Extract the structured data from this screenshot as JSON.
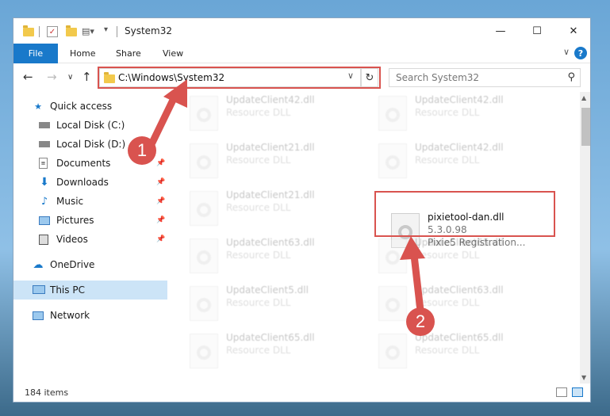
{
  "window": {
    "title": "System32",
    "controls": {
      "minimize": "—",
      "maximize": "☐",
      "close": "✕"
    }
  },
  "ribbon": {
    "tabs": [
      "File",
      "Home",
      "Share",
      "View"
    ],
    "help": "?",
    "collapse": "∨",
    "accent": "#1979ca"
  },
  "nav": {
    "back": "←",
    "forward": "→",
    "recent": "∨",
    "up": "↑",
    "address": "C:\\Windows\\System32",
    "refresh": "↻",
    "search_placeholder": "Search System32"
  },
  "sidebar": {
    "items": [
      {
        "label": "Quick access",
        "icon": "star-icon",
        "pinned": false
      },
      {
        "label": "Local Disk (C:)",
        "icon": "drive-icon",
        "pinned": false
      },
      {
        "label": "Local Disk (D:)",
        "icon": "drive-icon",
        "pinned": false
      },
      {
        "label": "Documents",
        "icon": "document-icon",
        "pinned": true
      },
      {
        "label": "Downloads",
        "icon": "download-icon",
        "pinned": true
      },
      {
        "label": "Music",
        "icon": "music-icon",
        "pinned": true
      },
      {
        "label": "Pictures",
        "icon": "pictures-icon",
        "pinned": true
      },
      {
        "label": "Videos",
        "icon": "videos-icon",
        "pinned": true
      },
      {
        "label": "OneDrive",
        "icon": "cloud-icon",
        "pinned": false
      },
      {
        "label": "This PC",
        "icon": "computer-icon",
        "pinned": false,
        "selected": true
      },
      {
        "label": "Network",
        "icon": "network-icon",
        "pinned": false
      }
    ]
  },
  "files": [
    {
      "name": "UpdateClient42.dll",
      "desc": "Resource DLL"
    },
    {
      "name": "UpdateClient42.dll",
      "desc": "Resource DLL"
    },
    {
      "name": "UpdateClient21.dll",
      "desc": "Resource DLL"
    },
    {
      "name": "UpdateClient42.dll",
      "desc": "Resource DLL"
    },
    {
      "name": "UpdateClient21.dll",
      "desc": "Resource DLL"
    },
    {
      "name": "pixietool-dan.dll",
      "version": "5.3.0.98",
      "desc": "Pixie5 Registration...",
      "highlighted": true
    },
    {
      "name": "UpdateClient63.dll",
      "desc": "Resource DLL"
    },
    {
      "name": "UpdateClient65.dll",
      "desc": "Resource DLL"
    },
    {
      "name": "UpdateClient5.dll",
      "desc": "Resource DLL"
    },
    {
      "name": "UpdateClient63.dll",
      "desc": "Resource DLL"
    },
    {
      "name": "UpdateClient65.dll",
      "desc": "Resource DLL"
    },
    {
      "name": "UpdateClient65.dll",
      "desc": "Resource DLL"
    }
  ],
  "status": {
    "count": "184 items"
  },
  "annotations": {
    "step1": "1",
    "step2": "2",
    "color": "#d9534f"
  }
}
